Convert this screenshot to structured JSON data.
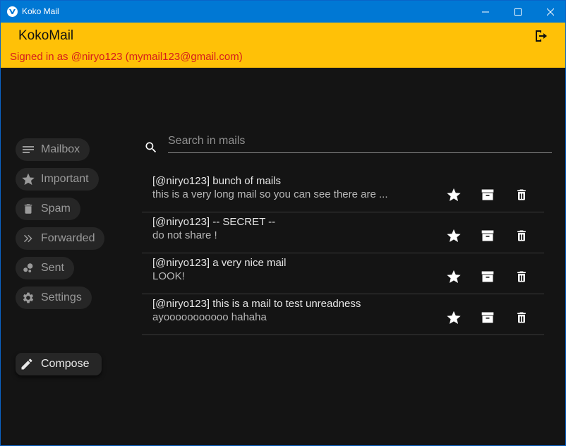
{
  "window": {
    "title": "Koko Mail",
    "controls": [
      "minimize-icon",
      "maximize-icon",
      "close-icon"
    ],
    "accent": "#0078d4"
  },
  "header": {
    "brand": "KokoMail",
    "signed_in": "Signed in as @niryo123 (mymail123@gmail.com)",
    "background": "#ffc107",
    "signed_in_color": "#d51d1d",
    "logout_icon": "logout-icon"
  },
  "sidebar": {
    "items": [
      {
        "label": "Mailbox",
        "icon": "list-lines-icon"
      },
      {
        "label": "Important",
        "icon": "star-icon"
      },
      {
        "label": "Spam",
        "icon": "trash-icon"
      },
      {
        "label": "Forwarded",
        "icon": "double-chevron-icon"
      },
      {
        "label": "Sent",
        "icon": "bubbles-icon"
      },
      {
        "label": "Settings",
        "icon": "gear-icon"
      }
    ],
    "compose": {
      "label": "Compose",
      "icon": "pencil-icon"
    }
  },
  "search": {
    "placeholder": "Search in mails",
    "value": ""
  },
  "mails": [
    {
      "subject": "[@niryo123] bunch of mails",
      "preview": "this is a very long mail so you can see there are ..."
    },
    {
      "subject": "[@niryo123] -- SECRET --",
      "preview": "do not share !"
    },
    {
      "subject": "[@niryo123] a very nice mail",
      "preview": "LOOK!"
    },
    {
      "subject": "[@niryo123] this is a mail to test unreadness",
      "preview": "ayooooooooooo hahaha"
    }
  ],
  "mail_actions": [
    "star-icon",
    "archive-icon",
    "delete-icon"
  ]
}
